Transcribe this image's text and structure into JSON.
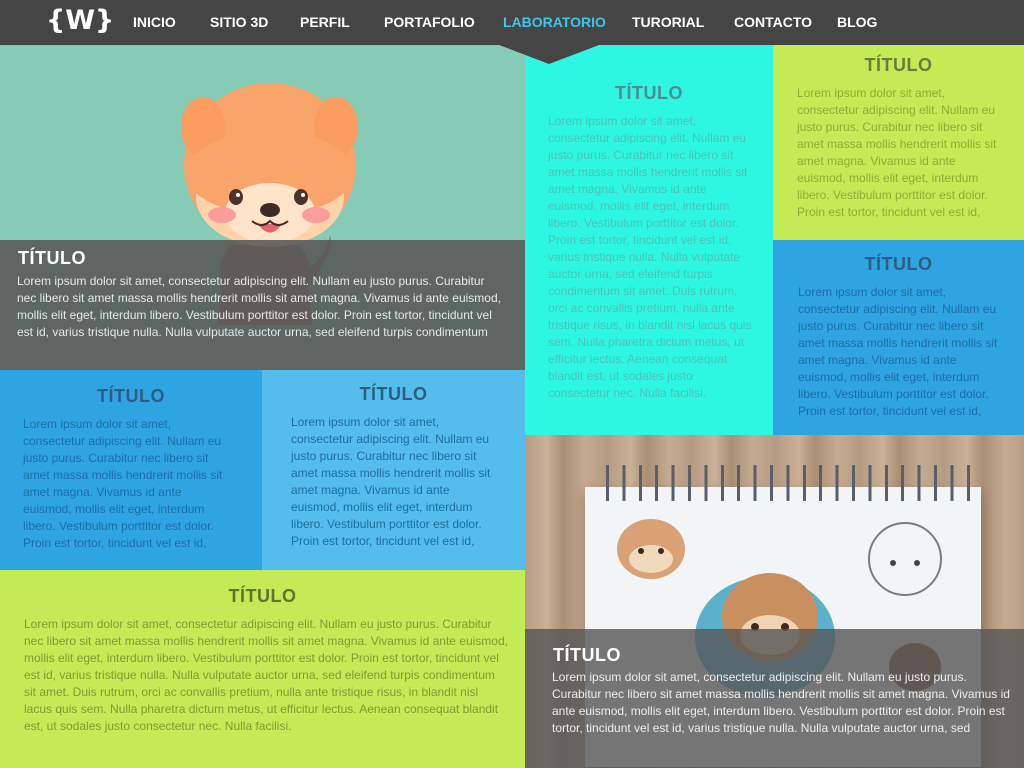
{
  "nav": {
    "logo": "{W}",
    "items": [
      {
        "label": "INICIO",
        "active": false
      },
      {
        "label": "SITIO 3D",
        "active": false
      },
      {
        "label": "PERFIL",
        "active": false
      },
      {
        "label": "PORTAFOLIO",
        "active": false
      },
      {
        "label": "LABORATORIO",
        "active": true
      },
      {
        "label": "TURORIAL",
        "active": false
      },
      {
        "label": "CONTACTO",
        "active": false
      },
      {
        "label": "BLOG",
        "active": false
      }
    ]
  },
  "colors": {
    "nav_bg": "#454545",
    "nav_active": "#3ec8e8",
    "teal": "#86cbb6",
    "cyan": "#2df7e2",
    "lime": "#c3eb56",
    "blue": "#2fa4e2",
    "light_blue": "#55bcee"
  },
  "hero": {
    "title": "TÍTULO",
    "text": "Lorem ipsum dolor sit amet, consectetur adipiscing elit. Nullam eu justo purus. Curabitur nec libero sit amet massa mollis hendrerit mollis sit amet magna. Vivamus id ante euismod, mollis elit eget, interdum libero. Vestibulum porttitor est dolor. Proin est tortor, tincidunt vel est id, varius tristique nulla. Nulla vulputate auctor urna, sed eleifend turpis condimentum"
  },
  "cyan_block": {
    "title": "TÍTULO",
    "text": "Lorem ipsum dolor sit amet, consectetur adipiscing elit. Nullam eu justo purus. Curabitur nec libero sit amet massa mollis hendrerit mollis sit amet magna. Vivamus id ante euismod, mollis elit eget, interdum libero. Vestibulum porttitor est dolor. Proin est tortor, tincidunt vel est id, varius tristique nulla. Nulla vulputate auctor urna, sed eleifend turpis condimentum sit amet. Duis rutrum, orci ac convallis pretium, nulla ante tristique risus, in blandit nisl lacus quis sem. Nulla pharetra dictum metus, ut efficitur lectus. Aenean consequat blandit est, ut sodales justo consectetur nec. Nulla facilisi."
  },
  "lime_block_1": {
    "title": "TÍTULO",
    "text": "Lorem ipsum dolor sit amet, consectetur adipiscing elit. Nullam eu justo purus. Curabitur nec libero sit amet massa mollis hendrerit mollis sit amet magna. Vivamus id ante euismod, mollis elit eget, interdum libero. Vestibulum porttitor est dolor. Proin est tortor, tincidunt vel est id,"
  },
  "blue_block_1": {
    "title": "TÍTULO",
    "text": "Lorem ipsum dolor sit amet, consectetur adipiscing elit. Nullam eu justo purus. Curabitur nec libero sit amet massa mollis hendrerit mollis sit amet magna. Vivamus id ante euismod, mollis elit eget, interdum libero. Vestibulum porttitor est dolor. Proin est tortor, tincidunt vel est id,"
  },
  "blue_block_2": {
    "title": "TÍTULO",
    "text": "Lorem ipsum dolor sit amet, consectetur adipiscing elit. Nullam eu justo purus. Curabitur nec libero sit amet massa mollis hendrerit mollis sit amet magna. Vivamus id ante euismod, mollis elit eget, interdum libero. Vestibulum porttitor est dolor. Proin est tortor, tincidunt vel est id,"
  },
  "blue_block_3": {
    "title": "TÍTULO",
    "text": "Lorem ipsum dolor sit amet, consectetur adipiscing elit. Nullam eu justo purus. Curabitur nec libero sit amet massa mollis hendrerit mollis sit amet magna. Vivamus id ante euismod, mollis elit eget, interdum libero. Vestibulum porttitor est dolor. Proin est tortor, tincidunt vel est id,"
  },
  "lime_block_2": {
    "title": "TÍTULO",
    "text": "Lorem ipsum dolor sit amet, consectetur adipiscing elit. Nullam eu justo purus. Curabitur nec libero sit amet massa mollis hendrerit mollis sit amet magna. Vivamus id ante euismod, mollis elit eget, interdum libero. Vestibulum porttitor est dolor. Proin est tortor, tincidunt vel est id, varius tristique nulla. Nulla vulputate auctor urna, sed eleifend turpis condimentum sit amet. Duis rutrum, orci ac convallis pretium, nulla ante tristique risus, in blandit nisl lacus quis sem. Nulla pharetra dictum metus, ut efficitur lectus. Aenean consequat blandit est, ut sodales justo consectetur nec. Nulla facilisi."
  },
  "photo_block": {
    "title": "TÍTULO",
    "text": "Lorem ipsum dolor sit amet, consectetur adipiscing elit. Nullam eu justo purus. Curabitur nec libero sit amet massa mollis hendrerit mollis sit amet magna. Vivamus id ante euismod, mollis elit eget, interdum libero. Vestibulum porttitor est dolor. Proin est tortor, tincidunt vel est id, varius tristique nulla. Nulla vulputate auctor urna, sed"
  }
}
